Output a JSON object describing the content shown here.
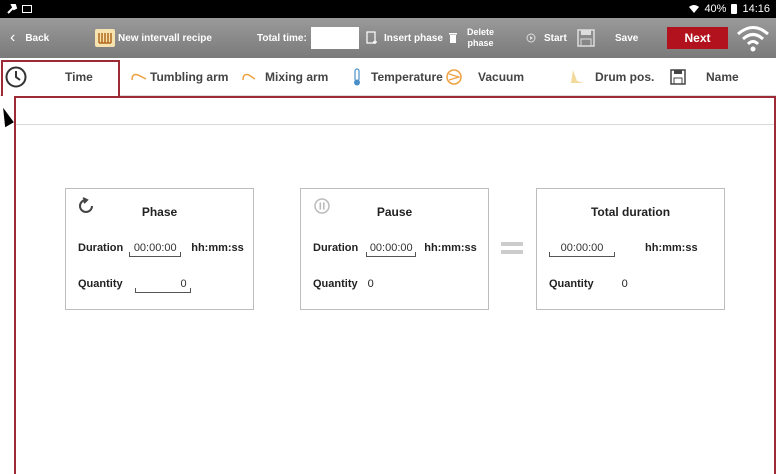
{
  "status_bar": {
    "battery": "40%",
    "time": "14:16"
  },
  "toolbar": {
    "back_label": "Back",
    "recipe_label": "New intervall recipe",
    "total_time_label": "Total time:",
    "total_time_value": "",
    "insert_phase_label": "Insert phase",
    "delete_phase_line1": "Delete",
    "delete_phase_line2": "phase",
    "start_label": "Start",
    "save_label": "Save",
    "next_label": "Next"
  },
  "tabs": [
    {
      "label": "Time",
      "icon": "clock-icon",
      "active": true
    },
    {
      "label": "Tumbling arm",
      "icon": "tumbling-arm-icon"
    },
    {
      "label": "Mixing arm",
      "icon": "mixing-arm-icon"
    },
    {
      "label": "Temperature",
      "icon": "thermometer-icon"
    },
    {
      "label": "Vacuum",
      "icon": "vacuum-icon"
    },
    {
      "label": "Drum pos.",
      "icon": "drum-position-icon"
    },
    {
      "label": "Name",
      "icon": "save-disk-icon"
    }
  ],
  "cards": {
    "phase": {
      "title": "Phase",
      "duration_label": "Duration",
      "duration_value": "00:00:00",
      "duration_unit": "hh:mm:ss",
      "quantity_label": "Quantity",
      "quantity_value": "0"
    },
    "pause": {
      "title": "Pause",
      "duration_label": "Duration",
      "duration_value": "00:00:00",
      "duration_unit": "hh:mm:ss",
      "quantity_label": "Quantity",
      "quantity_value": "0"
    },
    "total": {
      "title": "Total duration",
      "duration_value": "00:00:00",
      "duration_unit": "hh:mm:ss",
      "quantity_label": "Quantity",
      "quantity_value": "0"
    }
  },
  "colors": {
    "accent": "#9c2b35",
    "next_button": "#b1121d",
    "toolbar": "#8a8a8a"
  }
}
